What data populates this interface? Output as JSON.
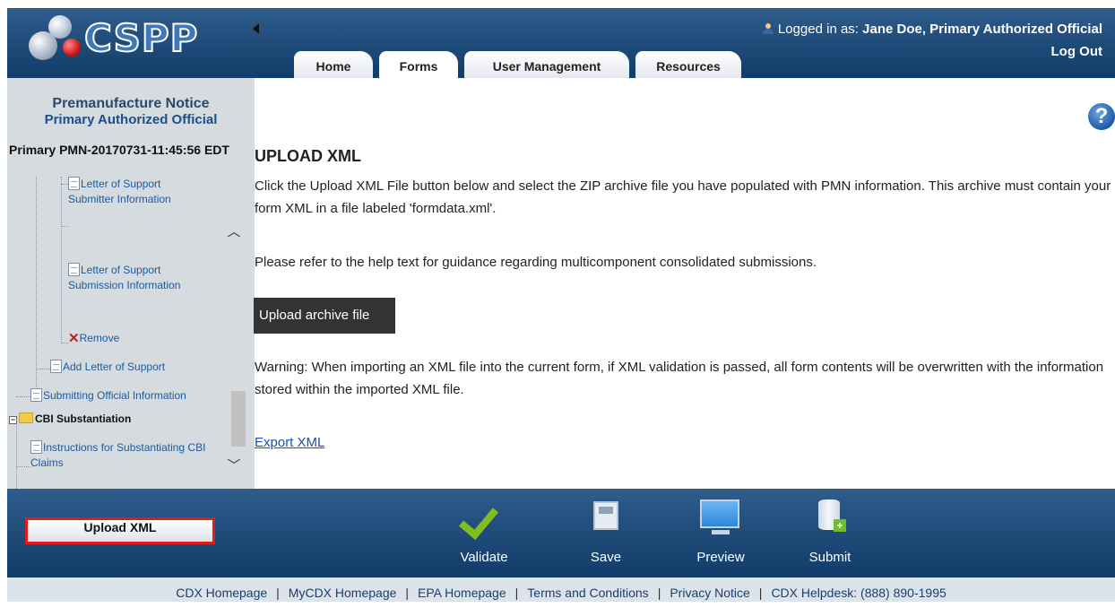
{
  "app": {
    "logo_text": "CSPP"
  },
  "header": {
    "tabs": [
      {
        "label": "Home"
      },
      {
        "label": "Forms"
      },
      {
        "label": "User Management"
      },
      {
        "label": "Resources"
      }
    ],
    "login_prefix": "Logged in as: ",
    "login_user": "Jane Doe, Primary Authorized Official",
    "logout_label": "Log Out"
  },
  "sidebar": {
    "title": "Premanufacture Notice",
    "subtitle": "Primary Authorized Official",
    "record_id": "Primary PMN-20170731-11:45:56 EDT",
    "tree": [
      {
        "label": "Letter of Support Submitter Information"
      },
      {
        "label": "Letter of Support Submission Information"
      },
      {
        "label": "Remove"
      },
      {
        "label": "Add Letter of Support"
      },
      {
        "label": "Submitting Official Information"
      },
      {
        "label": "CBI Substantiation"
      },
      {
        "label": "Instructions for Substantiating CBI Claims"
      }
    ]
  },
  "main": {
    "title": "UPLOAD XML",
    "paragraph1": "Click the Upload XML File button below and select the ZIP archive file you have populated with PMN information. This archive must contain your form XML in a file labeled 'formdata.xml'.",
    "paragraph2": "Please refer to the help text for guidance regarding multicomponent consolidated submissions.",
    "upload_button": "Upload archive file",
    "warning": "Warning: When importing an XML file into the current form, if XML validation is passed, all form contents will be overwritten with the information stored within the imported XML file.",
    "export_link": "Export XML",
    "help_glyph": "?"
  },
  "footer_bar": {
    "upload_xml": "Upload XML",
    "tools": [
      {
        "label": "Validate",
        "icon": "check-icon"
      },
      {
        "label": "Save",
        "icon": "save-icon"
      },
      {
        "label": "Preview",
        "icon": "monitor-icon"
      },
      {
        "label": "Submit",
        "icon": "database-icon"
      }
    ]
  },
  "footer_links": [
    {
      "label": "CDX Homepage"
    },
    {
      "label": "MyCDX Homepage"
    },
    {
      "label": "EPA Homepage"
    },
    {
      "label": "Terms and Conditions"
    },
    {
      "label": "Privacy Notice"
    },
    {
      "label": "CDX Helpdesk: (888) 890-1995"
    }
  ],
  "colors": {
    "header_blue": "#1e4a78",
    "panel_gray": "#d6dbe0",
    "highlight_red": "#e01b1b",
    "link_blue": "#1a4fb5"
  }
}
